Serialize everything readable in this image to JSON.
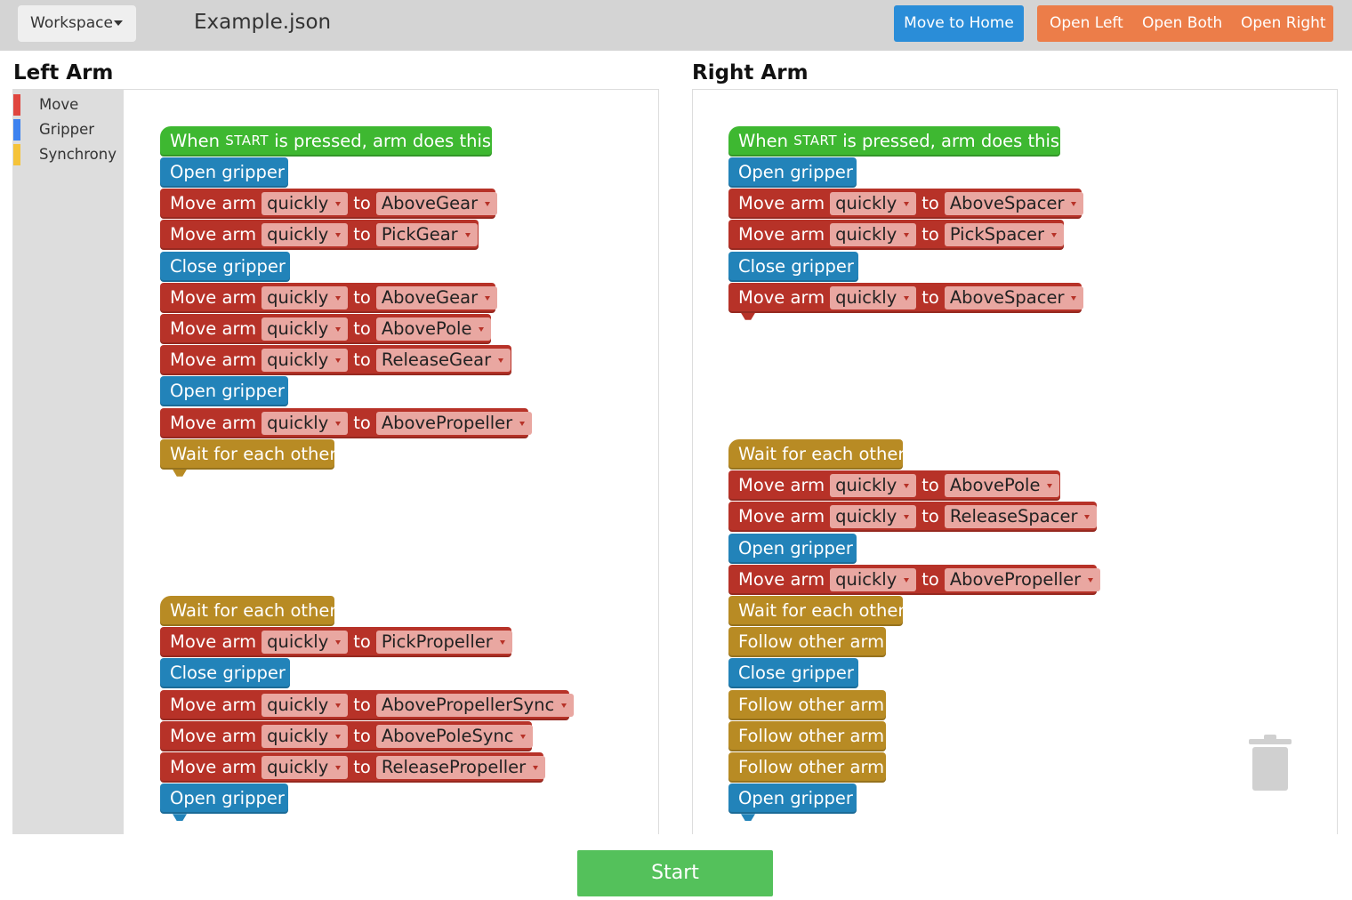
{
  "topbar": {
    "workspace_label": "Workspace",
    "filename": "Example.json",
    "move_home": "Move to Home",
    "open_left": "Open Left",
    "open_both": "Open Both",
    "open_right": "Open Right"
  },
  "colors": {
    "move": "#b73228",
    "gripper": "#2283b9",
    "synchrony": "#b88b24",
    "start_block": "#3eb831",
    "start_button": "#54c15b",
    "home_button": "#2a8dd8",
    "gripper_buttons": "#ec7d49"
  },
  "left": {
    "title": "Left Arm",
    "toolbox": [
      "Move",
      "Gripper",
      "Synchrony"
    ],
    "start_block": {
      "pre": "When",
      "key": "start",
      "post": "is pressed, arm does this:"
    },
    "blocks1": [
      {
        "label": "Open gripper"
      },
      {
        "label": "Move arm",
        "speed": "quickly",
        "to": "to",
        "target": "AboveGear"
      },
      {
        "label": "Move arm",
        "speed": "quickly",
        "to": "to",
        "target": "PickGear"
      },
      {
        "label": "Close gripper"
      },
      {
        "label": "Move arm",
        "speed": "quickly",
        "to": "to",
        "target": "AboveGear"
      },
      {
        "label": "Move arm",
        "speed": "quickly",
        "to": "to",
        "target": "AbovePole"
      },
      {
        "label": "Move arm",
        "speed": "quickly",
        "to": "to",
        "target": "ReleaseGear"
      },
      {
        "label": "Open gripper"
      },
      {
        "label": "Move arm",
        "speed": "quickly",
        "to": "to",
        "target": "AbovePropeller"
      },
      {
        "label": "Wait for each other"
      }
    ],
    "blocks2": [
      {
        "label": "Wait for each other"
      },
      {
        "label": "Move arm",
        "speed": "quickly",
        "to": "to",
        "target": "PickPropeller"
      },
      {
        "label": "Close gripper"
      },
      {
        "label": "Move arm",
        "speed": "quickly",
        "to": "to",
        "target": "AbovePropellerSync"
      },
      {
        "label": "Move arm",
        "speed": "quickly",
        "to": "to",
        "target": "AbovePoleSync"
      },
      {
        "label": "Move arm",
        "speed": "quickly",
        "to": "to",
        "target": "ReleasePropeller"
      },
      {
        "label": "Open gripper"
      }
    ]
  },
  "right": {
    "title": "Right Arm",
    "start_block": {
      "pre": "When",
      "key": "start",
      "post": "is pressed, arm does this:"
    },
    "blocks1": [
      {
        "label": "Open gripper"
      },
      {
        "label": "Move arm",
        "speed": "quickly",
        "to": "to",
        "target": "AboveSpacer"
      },
      {
        "label": "Move arm",
        "speed": "quickly",
        "to": "to",
        "target": "PickSpacer"
      },
      {
        "label": "Close gripper"
      },
      {
        "label": "Move arm",
        "speed": "quickly",
        "to": "to",
        "target": "AboveSpacer"
      }
    ],
    "blocks2": [
      {
        "label": "Wait for each other"
      },
      {
        "label": "Move arm",
        "speed": "quickly",
        "to": "to",
        "target": "AbovePole"
      },
      {
        "label": "Move arm",
        "speed": "quickly",
        "to": "to",
        "target": "ReleaseSpacer"
      },
      {
        "label": "Open gripper"
      },
      {
        "label": "Move arm",
        "speed": "quickly",
        "to": "to",
        "target": "AbovePropeller"
      },
      {
        "label": "Wait for each other"
      },
      {
        "label": "Follow other arm"
      },
      {
        "label": "Close gripper"
      },
      {
        "label": "Follow other arm"
      },
      {
        "label": "Follow other arm"
      },
      {
        "label": "Follow other arm"
      },
      {
        "label": "Open gripper"
      }
    ]
  },
  "start_button": "Start"
}
